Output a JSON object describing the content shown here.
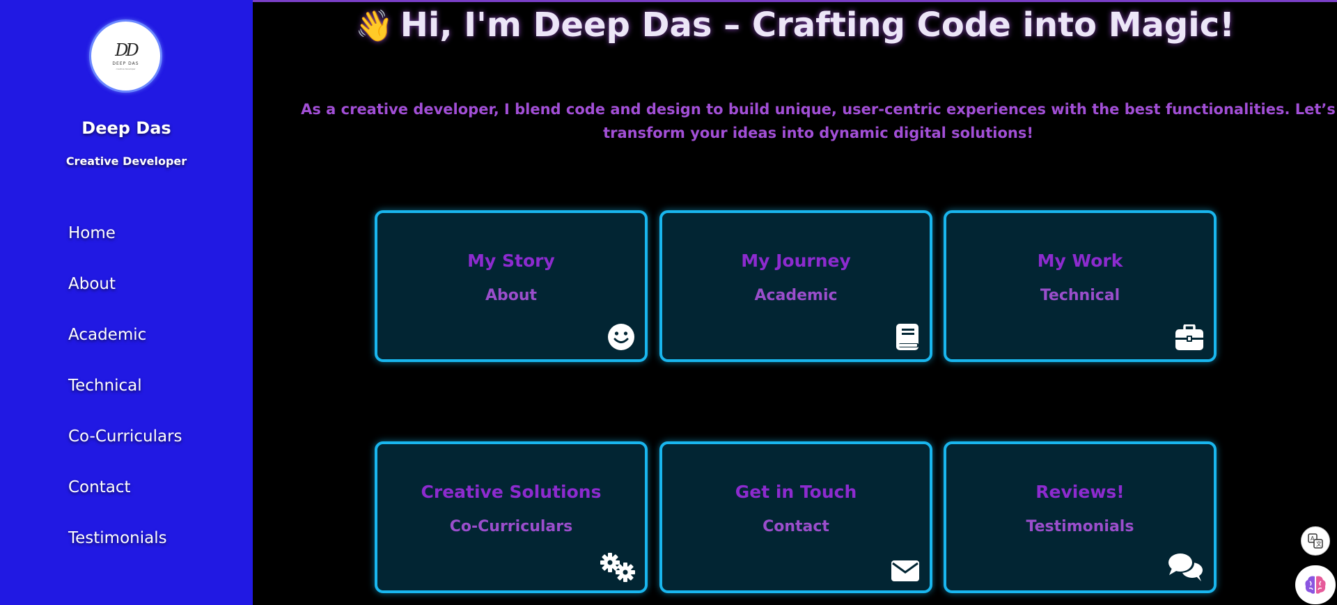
{
  "sidebar": {
    "logo": {
      "mark": "DD",
      "text": "DEEP DAS",
      "subtext": "creative developer"
    },
    "name": "Deep Das",
    "role": "Creative Developer",
    "nav": [
      "Home",
      "About",
      "Academic",
      "Technical",
      "Co-Curriculars",
      "Contact",
      "Testimonials"
    ]
  },
  "hero": {
    "emoji": "👋",
    "title": "Hi, I'm Deep Das – Crafting Code into Magic!",
    "subtitle_line1": "As a creative developer, I blend code and design to build unique, user-centric experiences with the best functionalities. Let’s",
    "subtitle_line2": "transform your ideas into dynamic digital solutions!"
  },
  "cards": [
    {
      "title": "My Story",
      "subtitle": "About",
      "icon": "smile-icon"
    },
    {
      "title": "My Journey",
      "subtitle": "Academic",
      "icon": "book-icon"
    },
    {
      "title": "My Work",
      "subtitle": "Technical",
      "icon": "briefcase-icon"
    },
    {
      "title": "Creative Solutions",
      "subtitle": "Co-Curriculars",
      "icon": "gears-icon"
    },
    {
      "title": "Get in Touch",
      "subtitle": "Contact",
      "icon": "envelope-icon"
    },
    {
      "title": "Reviews!",
      "subtitle": "Testimonials",
      "icon": "comments-icon"
    }
  ],
  "colors": {
    "sidebar_bg": "#2119e3",
    "card_bg": "#022533",
    "card_border": "#19b6ee",
    "accent_purple": "#8d2bcf",
    "page_bg": "#000000"
  }
}
